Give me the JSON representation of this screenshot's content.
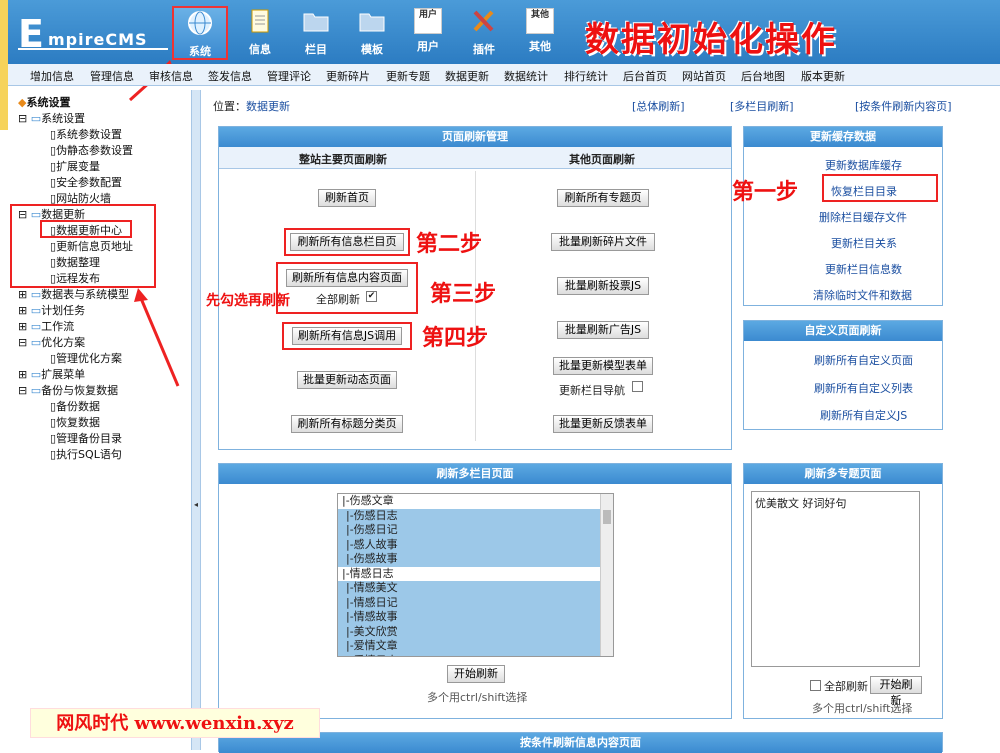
{
  "header": {
    "logo_e": "E",
    "logo_rest": "mpireCMS",
    "page_heading": "数据初始化操作",
    "nav": [
      "系统",
      "信息",
      "栏目",
      "模板",
      "用户",
      "插件",
      "其他"
    ],
    "nav_icon_alt_user": "用户",
    "nav_icon_alt_other": "其他"
  },
  "menubar": [
    "增加信息",
    "管理信息",
    "审核信息",
    "签发信息",
    "管理评论",
    "更新碎片",
    "更新专题",
    "数据更新",
    "数据统计",
    "排行统计",
    "后台首页",
    "网站首页",
    "后台地图",
    "版本更新"
  ],
  "sidebar": {
    "root": "系统设置",
    "sys": "系统设置",
    "sys_items": [
      "系统参数设置",
      "伪静态参数设置",
      "扩展变量",
      "安全参数配置",
      "网站防火墙"
    ],
    "data": "数据更新",
    "data_items": [
      "数据更新中心",
      "更新信息页地址",
      "数据整理",
      "远程发布"
    ],
    "groups": [
      "数据表与系统模型",
      "计划任务",
      "工作流"
    ],
    "opt": "优化方案",
    "opt_items": [
      "管理优化方案"
    ],
    "ext": "扩展菜单",
    "backup": "备份与恢复数据",
    "backup_items": [
      "备份数据",
      "恢复数据",
      "管理备份目录",
      "执行SQL语句"
    ]
  },
  "location": {
    "label": "位置：",
    "link": "数据更新",
    "tabs": [
      "[总体刷新]",
      "[多栏目刷新]",
      "[按条件刷新内容页]"
    ]
  },
  "refresh_panel": {
    "title": "页面刷新管理",
    "col1": "整站主要页面刷新",
    "col2": "其他页面刷新",
    "left_buttons": [
      "刷新首页",
      "刷新所有信息栏目页",
      "刷新所有信息内容页面",
      "刷新所有信息JS调用",
      "批量更新动态页面",
      "刷新所有标题分类页"
    ],
    "full_refresh": "全部刷新",
    "right_buttons": [
      "刷新所有专题页",
      "批量刷新碎片文件",
      "批量刷新投票JS",
      "批量刷新广告JS",
      "批量更新模型表单",
      "批量更新反馈表单"
    ],
    "update_nav": "更新栏目导航"
  },
  "cache_panel": {
    "title": "更新缓存数据",
    "links": [
      "更新数据库缓存",
      "恢复栏目目录",
      "删除栏目缓存文件",
      "更新栏目关系",
      "更新栏目信息数",
      "清除临时文件和数据"
    ]
  },
  "custom_panel": {
    "title": "自定义页面刷新",
    "links": [
      "刷新所有自定义页面",
      "刷新所有自定义列表",
      "刷新所有自定义JS"
    ]
  },
  "multi_class": {
    "title": "刷新多栏目页面",
    "options": [
      "|-伤感文章",
      "|-伤感日志",
      "|-伤感日记",
      "|-感人故事",
      "|-伤感故事",
      "|-情感日志",
      "|-情感美文",
      "|-情感日记",
      "|-情感故事",
      "|-美文欣赏",
      "|-爱情文章",
      "|-爱情日志"
    ],
    "selected": [
      false,
      true,
      true,
      true,
      true,
      false,
      true,
      true,
      true,
      true,
      true,
      true
    ],
    "start": "开始刷新",
    "hint": "多个用ctrl/shift选择"
  },
  "multi_topic": {
    "title": "刷新多专题页面",
    "content": "优美散文 好词好句",
    "full": "全部刷新",
    "start": "开始刷新",
    "hint": "多个用ctrl/shift选择"
  },
  "bottom_title": "按条件刷新信息内容页面",
  "annotations": {
    "step1": "第一步",
    "step2": "第二步",
    "step3": "第三步",
    "step4": "第四步",
    "tip": "先勾选再刷新",
    "watermark": "网风时代 www.wenxin.xyz"
  },
  "colors": {
    "accent": "#2c7cc2",
    "annotation": "#e11111",
    "selection": "#9cc8e8"
  }
}
